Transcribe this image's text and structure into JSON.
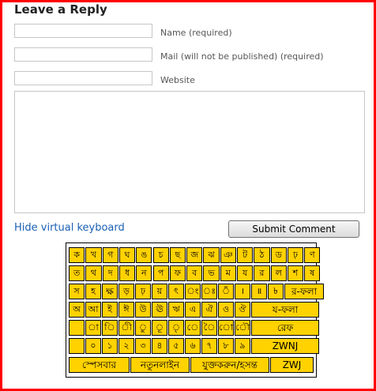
{
  "form": {
    "title": "Leave a Reply",
    "name_label": "Name (required)",
    "mail_label": "Mail (will not be published) (required)",
    "website_label": "Website",
    "hide_keyboard": "Hide virtual keyboard",
    "submit": "Submit Comment"
  },
  "keyboard": {
    "rows": [
      [
        "ক",
        "খ",
        "গ",
        "ঘ",
        "ঙ",
        "চ",
        "ছ",
        "জ",
        "ঝ",
        "ঞ",
        "ট",
        "ঠ",
        "ড",
        "ঢ়",
        "ণ"
      ],
      [
        "ত",
        "থ",
        "দ",
        "ধ",
        "ন",
        "প",
        "ফ",
        "ব",
        "ভ",
        "ম",
        "য",
        "র",
        "ল",
        "শ",
        "ষ"
      ],
      [
        "স",
        "হ",
        "ক্ষ",
        "ড়",
        "ঢ়",
        "য়",
        "ৎ",
        "ং",
        "ঃ",
        "ঁ",
        "।",
        "॥",
        "৳",
        "র-ফলা"
      ],
      [
        "অ",
        "আ",
        "ই",
        "ঈ",
        "উ",
        "ঊ",
        "ঋ",
        "এ",
        "ঐ",
        "ও",
        "ঔ",
        "য-ফলা"
      ],
      [
        "",
        "া",
        "ি",
        "ী",
        "ু",
        "ূ",
        "ৃ",
        "ে",
        "ৈ",
        "ো",
        "ৌ",
        "রেফ"
      ],
      [
        "",
        "০",
        "১",
        "২",
        "৩",
        "৪",
        "৫",
        "৬",
        "৭",
        "৮",
        "৯",
        "ZWNJ"
      ],
      [
        "স্পেসবার",
        "নতুনলাইন",
        "যুক্তকরুন/হসন্ত",
        "ZWJ"
      ]
    ]
  }
}
